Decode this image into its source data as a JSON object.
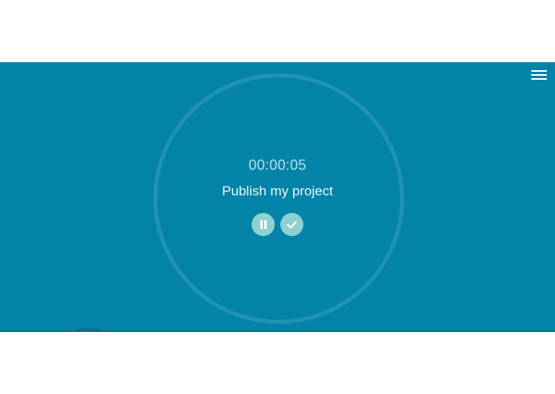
{
  "app": {
    "menu_icon": "hamburger-menu-icon",
    "colors": {
      "panel_background": "#0483a8",
      "ring": "#2d9bbb",
      "button_fill": "#8fd0d2",
      "elapsed_text": "#aee0e8",
      "title_text": "#eaf7fa"
    }
  },
  "timer": {
    "elapsed": "00:00:05",
    "task_title": "Publish my project",
    "pause_icon": "pause-icon",
    "complete_icon": "check-icon"
  }
}
